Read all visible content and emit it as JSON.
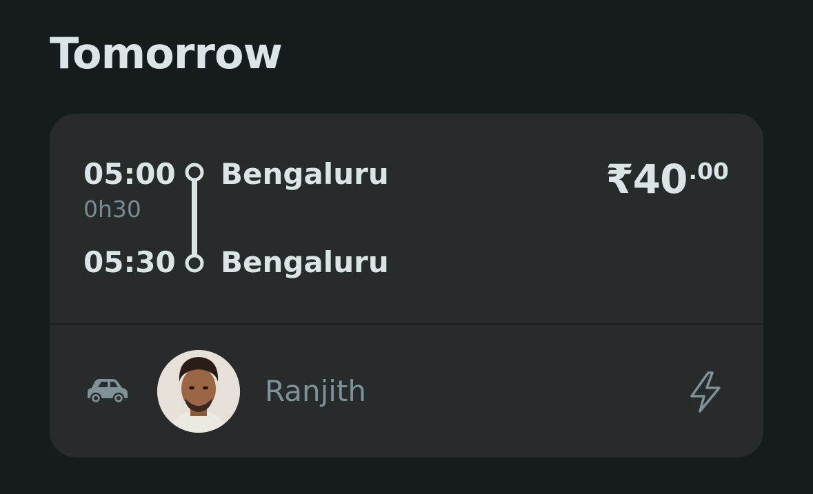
{
  "section": {
    "title": "Tomorrow"
  },
  "ride": {
    "departure_time": "05:00",
    "duration": "0h30",
    "arrival_time": "05:30",
    "departure_city": "Bengaluru",
    "arrival_city": "Bengaluru",
    "price_main": "₹40",
    "price_decimal": ".00",
    "vehicle_icon": "car-icon",
    "booking_icon": "lightning-bolt-icon"
  },
  "driver": {
    "name": "Ranjith"
  },
  "colors": {
    "background": "#161b1e",
    "card": "#272b2c",
    "text_primary": "#dbe4e6",
    "text_muted": "#7e9297"
  }
}
